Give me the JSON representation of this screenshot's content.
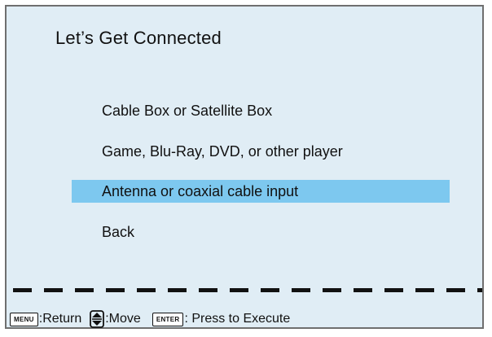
{
  "title": "Let’s Get Connected",
  "menu": {
    "items": [
      {
        "label": "Cable Box or Satellite Box"
      },
      {
        "label": "Game, Blu-Ray, DVD, or other player"
      },
      {
        "label": "Antenna or coaxial cable input"
      },
      {
        "label": "Back"
      }
    ],
    "selected_index": 2
  },
  "footer": {
    "menu_key": "MENU",
    "return_label": ":Return",
    "move_label": ":Move",
    "enter_key": "ENTER",
    "execute_label": ": Press to Execute"
  },
  "colors": {
    "background": "#e0edf5",
    "highlight": "#7dc8ef"
  },
  "icons": {
    "move": "up-down-arrow-icon"
  }
}
